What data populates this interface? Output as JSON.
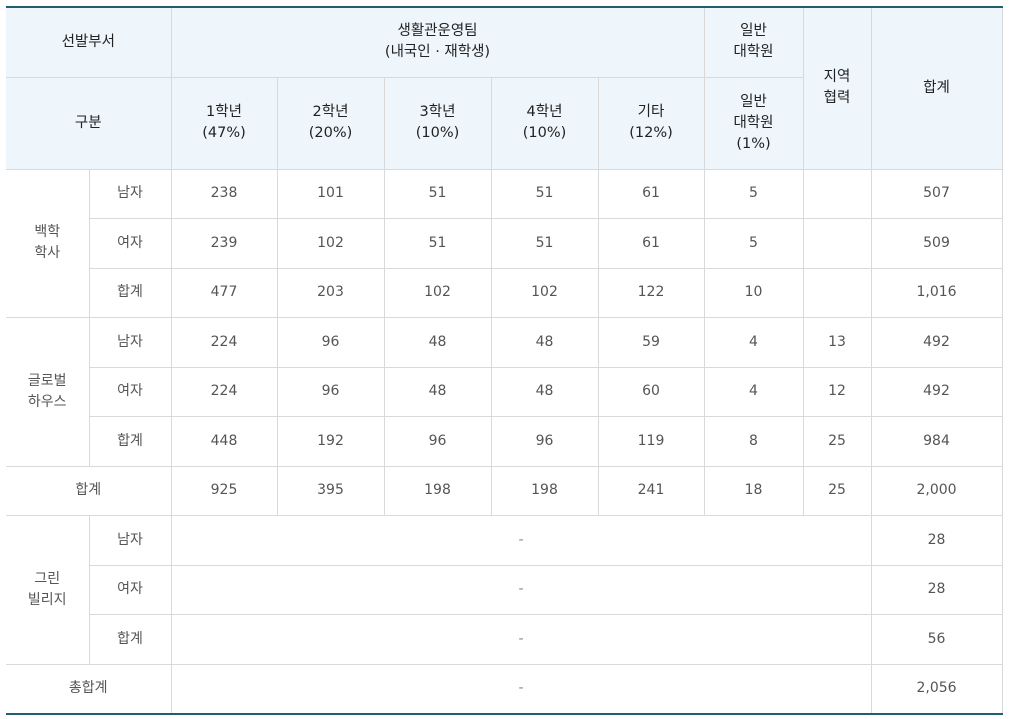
{
  "header": {
    "dept_label": "선발부서",
    "team_line1": "생활관운영팀",
    "team_line2": "(내국인 · 재학생)",
    "grad_top1": "일반",
    "grad_top2": "대학원",
    "regional1": "지역",
    "regional2": "협력",
    "total": "합계",
    "category": "구분",
    "cols": [
      {
        "l1": "1학년",
        "l2": "(47%)"
      },
      {
        "l1": "2학년",
        "l2": "(20%)"
      },
      {
        "l1": "3학년",
        "l2": "(10%)"
      },
      {
        "l1": "4학년",
        "l2": "(10%)"
      },
      {
        "l1": "기타",
        "l2": "(12%)"
      }
    ],
    "grad_sub1": "일반",
    "grad_sub2": "대학원",
    "grad_sub3": "(1%)"
  },
  "groups": [
    {
      "name1": "백학",
      "name2": "학사",
      "rows": [
        {
          "label": "남자",
          "vals": [
            "238",
            "101",
            "51",
            "51",
            "61",
            "5",
            "",
            "507"
          ]
        },
        {
          "label": "여자",
          "vals": [
            "239",
            "102",
            "51",
            "51",
            "61",
            "5",
            "",
            "509"
          ]
        },
        {
          "label": "합계",
          "vals": [
            "477",
            "203",
            "102",
            "102",
            "122",
            "10",
            "",
            "1,016"
          ]
        }
      ]
    },
    {
      "name1": "글로벌",
      "name2": "하우스",
      "rows": [
        {
          "label": "남자",
          "vals": [
            "224",
            "96",
            "48",
            "48",
            "59",
            "4",
            "13",
            "492"
          ]
        },
        {
          "label": "여자",
          "vals": [
            "224",
            "96",
            "48",
            "48",
            "60",
            "4",
            "12",
            "492"
          ]
        },
        {
          "label": "합계",
          "vals": [
            "448",
            "192",
            "96",
            "96",
            "119",
            "8",
            "25",
            "984"
          ]
        }
      ]
    }
  ],
  "subtotal": {
    "label": "합계",
    "vals": [
      "925",
      "395",
      "198",
      "198",
      "241",
      "18",
      "25",
      "2,000"
    ]
  },
  "green": {
    "name1": "그린",
    "name2": "빌리지",
    "rows": [
      {
        "label": "남자",
        "dash": "-",
        "total": "28"
      },
      {
        "label": "여자",
        "dash": "-",
        "total": "28"
      },
      {
        "label": "합계",
        "dash": "-",
        "total": "56"
      }
    ]
  },
  "grand": {
    "label": "총합계",
    "dash": "-",
    "total": "2,056"
  }
}
